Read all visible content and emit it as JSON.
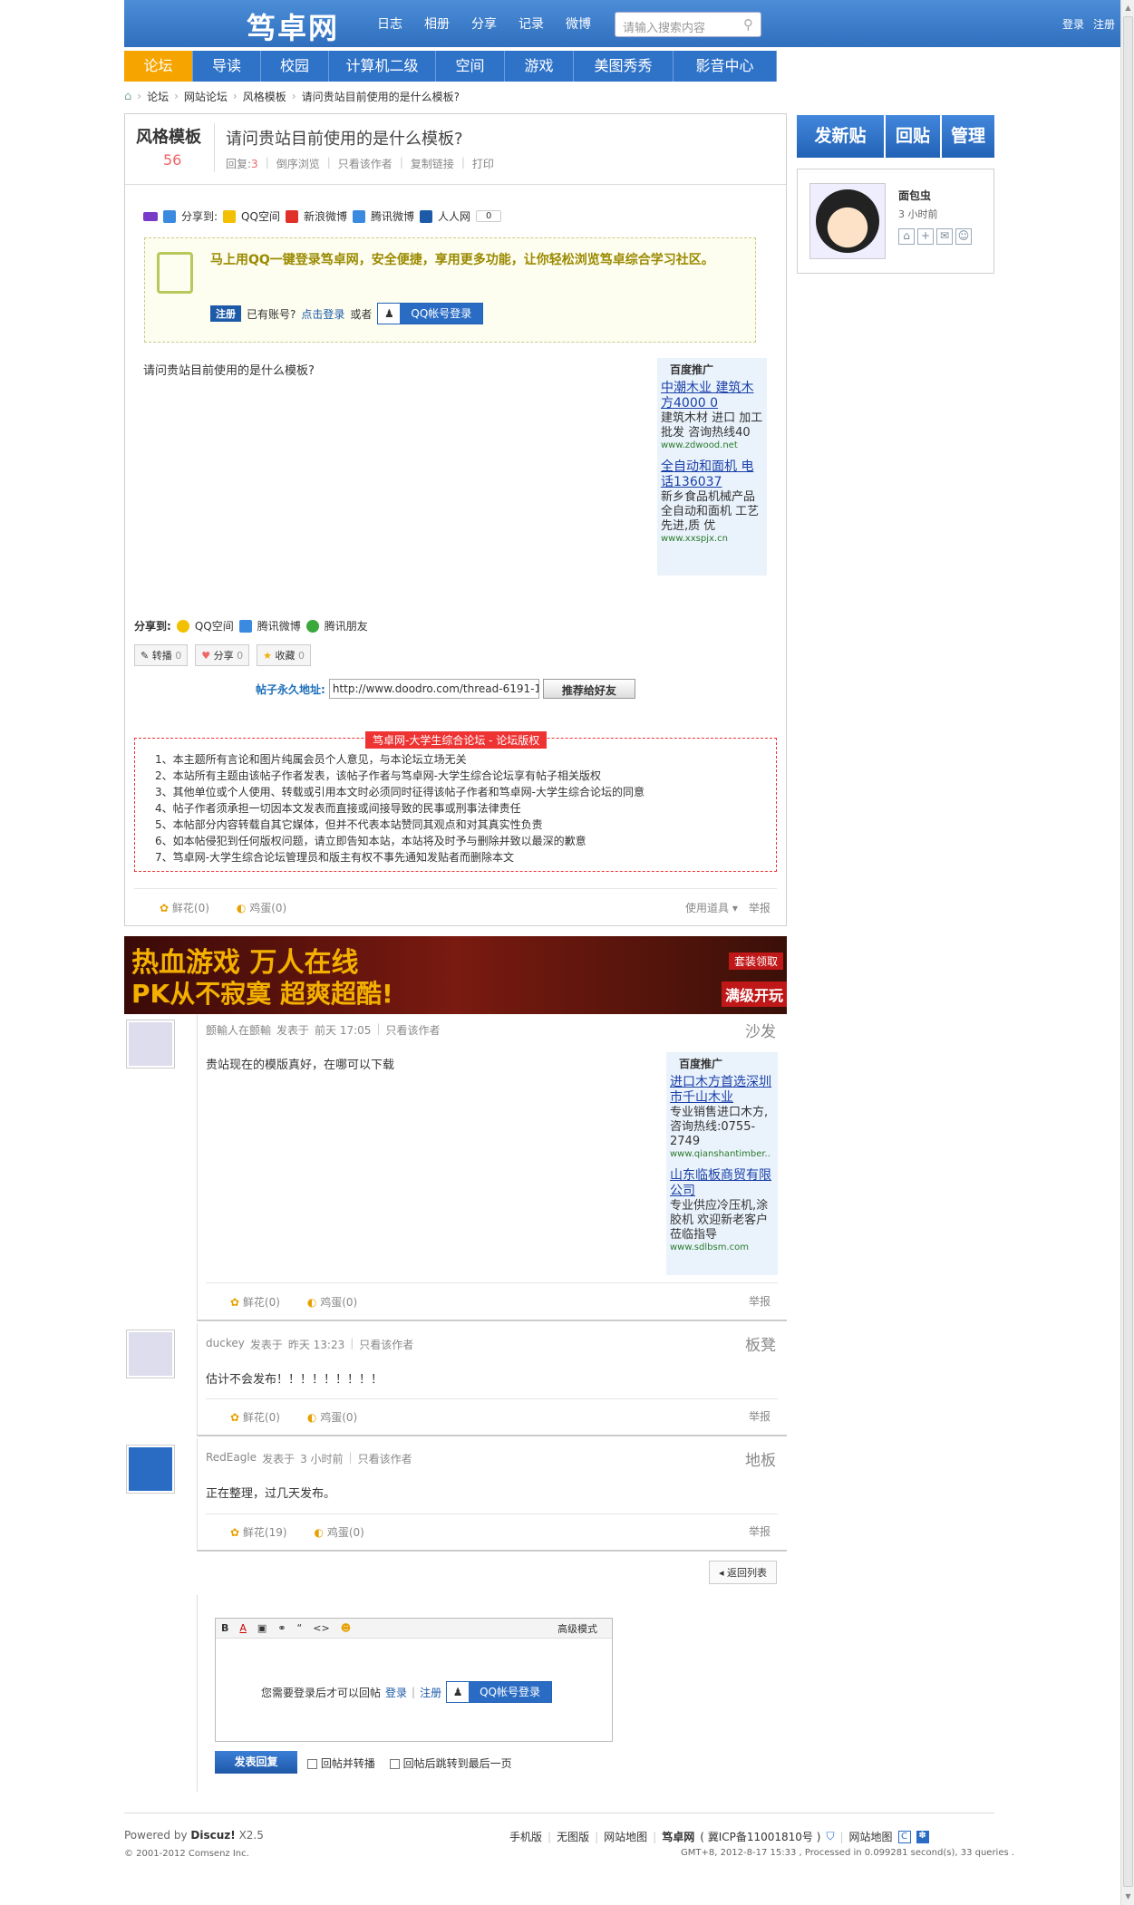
{
  "header": {
    "logo": "笃卓网",
    "nav": [
      "日志",
      "相册",
      "分享",
      "记录",
      "微博"
    ],
    "search_placeholder": "请输入搜索内容",
    "links": [
      "登录",
      "注册"
    ]
  },
  "mainnav": [
    "论坛",
    "导读",
    "校园",
    "计算机二级",
    "空间",
    "游戏",
    "美图秀秀",
    "影音中心"
  ],
  "breadcrumb": [
    "论坛",
    "网站论坛",
    "风格模板",
    "请问贵站目前使用的是什么模板?"
  ],
  "thread": {
    "category": "风格模板",
    "category_count": "56",
    "title": "请问贵站目前使用的是什么模板?",
    "meta": {
      "reply_label": "回复:",
      "reply_count": "3",
      "order": "倒序浏览",
      "only_author": "只看该作者",
      "copy": "复制链接",
      "print": "打印"
    },
    "share_top": {
      "label": "分享到:",
      "qzone": "QQ空间",
      "sina": "新浪微博",
      "tencent": "腾讯微博",
      "renren": "人人网",
      "count": "0"
    },
    "login_prompt": {
      "text": "马上用QQ一键登录笃卓网，安全便捷，享用更多功能，让你轻松浏览笃卓综合学习社区。",
      "register": "注册",
      "have_account": "已有账号?",
      "login_link": "点击登录",
      "or": "或者",
      "qq_login": "QQ帐号登录"
    },
    "body": "请问贵站目前使用的是什么模板?",
    "ad": {
      "head": "百度推广",
      "items": [
        {
          "title": "中潮木业 建筑木方4000 0",
          "desc": "建筑木材 进口 加工 批发 咨询热线40",
          "url": "www.zdwood.net"
        },
        {
          "title": "全自动和面机 电话136037",
          "desc": "新乡食品机械产品 全自动和面机 工艺先进,质 优",
          "url": "www.xxspjx.cn"
        }
      ]
    },
    "share_bottom": {
      "label": "分享到:",
      "qzone": "QQ空间",
      "tweibo": "腾讯微博",
      "tfriend": "腾讯朋友"
    },
    "buttons": {
      "forward": "转播",
      "forward_n": "0",
      "share": "分享",
      "share_n": "0",
      "fav": "收藏",
      "fav_n": "0"
    },
    "permalink": {
      "label": "帖子永久地址:",
      "url": "http://www.doodro.com/thread-6191-1",
      "recommend": "推荐给好友"
    },
    "notice": {
      "title": "笃卓网-大学生综合论坛 - 论坛版权",
      "lines": [
        "1、本主题所有言论和图片纯属会员个人意见，与本论坛立场无关",
        "2、本站所有主题由该帖子作者发表，该帖子作者与笃卓网-大学生综合论坛享有帖子相关版权",
        "3、其他单位或个人使用、转载或引用本文时必须同时征得该帖子作者和笃卓网-大学生综合论坛的同意",
        "4、帖子作者须承担一切因本文发表而直接或间接导致的民事或刑事法律责任",
        "5、本帖部分内容转载自其它媒体，但并不代表本站赞同其观点和对其真实性负责",
        "6、如本帖侵犯到任何版权问题，请立即告知本站，本站将及时予与删除并致以最深的歉意",
        "7、笃卓网-大学生综合论坛管理员和版主有权不事先通知发贴者而删除本文"
      ]
    },
    "flower": "鲜花(0)",
    "egg": "鸡蛋(0)",
    "tools": "使用道具",
    "report": "举报"
  },
  "sidebar": {
    "new_post": "发新贴",
    "reply": "回贴",
    "manage": "管理",
    "author": "面包虫",
    "time": "3 小时前"
  },
  "banner": {
    "line1": "热血游戏 万人在线",
    "line2": "PK从不寂寞 超爽超酷!",
    "tag": "套装领取",
    "tag2": "满级开玩"
  },
  "replies": [
    {
      "author": "颤輸人在颤輸",
      "posted": "发表于",
      "time": "前天 17:05",
      "only": "只看该作者",
      "floor": "沙发",
      "body": "贵站现在的模版真好，在哪可以下载",
      "flower": "鲜花(0)",
      "egg": "鸡蛋(0)",
      "report": "举报",
      "ad": {
        "head": "百度推广",
        "items": [
          {
            "title": "进口木方首选深圳市千山木业",
            "desc": "专业销售进口木方,咨询热线:0755-2749",
            "url": "www.qianshantimber.."
          },
          {
            "title": "山东临板商贸有限公司",
            "desc": "专业供应冷压机,涂胶机 欢迎新老客户莅临指导",
            "url": "www.sdlbsm.com"
          }
        ]
      }
    },
    {
      "author": "duckey",
      "posted": "发表于",
      "time": "昨天 13:23",
      "only": "只看该作者",
      "floor": "板凳",
      "body": "估计不会发布！！！！！！！！！",
      "flower": "鲜花(0)",
      "egg": "鸡蛋(0)",
      "report": "举报"
    },
    {
      "author": "RedEagle",
      "posted": "发表于",
      "time": "3 小时前",
      "only": "只看该作者",
      "floor": "地板",
      "body": "正在整理，过几天发布。",
      "flower": "鲜花(19)",
      "egg": "鸡蛋(0)",
      "report": "举报"
    }
  ],
  "back": "返回列表",
  "editor": {
    "advanced": "高级模式",
    "need_login": "您需要登录后才可以回帖",
    "login": "登录",
    "register": "注册",
    "qq_login": "QQ帐号登录",
    "submit": "发表回复",
    "opt1": "回帖并转播",
    "opt2": "回帖后跳转到最后一页"
  },
  "footer": {
    "powered": "Powered by",
    "brand": "Discuz!",
    "version": "X2.5",
    "copyright": "© 2001-2012 Comsenz Inc.",
    "links": [
      "手机版",
      "无图版",
      "网站地图"
    ],
    "site": "笃卓网",
    "icp": "( 冀ICP备11001810号 )",
    "sitemap": "网站地图",
    "gmt": "GMT+8, 2012-8-17 15:33 , Processed in 0.099281 second(s), 33 queries ."
  },
  "colors": {
    "blue": "#2f73c9",
    "orange": "#f6a500",
    "red": "#e33333"
  }
}
